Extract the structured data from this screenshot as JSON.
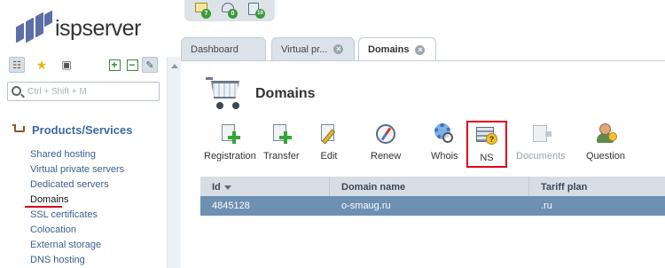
{
  "app": {
    "logo_text": "ispserver"
  },
  "quick_icons": [
    {
      "icon": "mail-icon",
      "badge": "7"
    },
    {
      "icon": "support-icon",
      "badge": "0"
    },
    {
      "icon": "documents-icon",
      "badge": "10"
    }
  ],
  "sidebar": {
    "search_placeholder": "Ctrl + Shift + M",
    "section_title": "Products/Services",
    "items": [
      {
        "label": "Shared hosting"
      },
      {
        "label": "Virtual private servers"
      },
      {
        "label": "Dedicated servers"
      },
      {
        "label": "Domains"
      },
      {
        "label": "SSL certificates"
      },
      {
        "label": "Colocation"
      },
      {
        "label": "External storage"
      },
      {
        "label": "DNS hosting"
      }
    ]
  },
  "tabs": [
    {
      "label": "Dashboard"
    },
    {
      "label": "Virtual pr..."
    },
    {
      "label": "Domains"
    }
  ],
  "main": {
    "title": "Domains",
    "actions": [
      {
        "label": "Registration",
        "icon": "registration-icon"
      },
      {
        "label": "Transfer",
        "icon": "transfer-icon"
      },
      {
        "label": "Edit",
        "icon": "edit-icon"
      },
      {
        "label": "Renew",
        "icon": "renew-icon"
      },
      {
        "label": "Whois",
        "icon": "whois-icon"
      },
      {
        "label": "NS",
        "icon": "ns-icon"
      },
      {
        "label": "Documents",
        "icon": "documents-icon"
      },
      {
        "label": "Question",
        "icon": "question-icon"
      }
    ]
  },
  "table": {
    "columns": [
      "Id",
      "Domain name",
      "Tariff plan"
    ],
    "rows": [
      [
        "4845128",
        "o-smaug.ru",
        ".ru"
      ]
    ]
  },
  "colors": {
    "accent": "#3d6aa0",
    "highlight": "#e0001b",
    "selected_row": "#6c8fb2"
  }
}
